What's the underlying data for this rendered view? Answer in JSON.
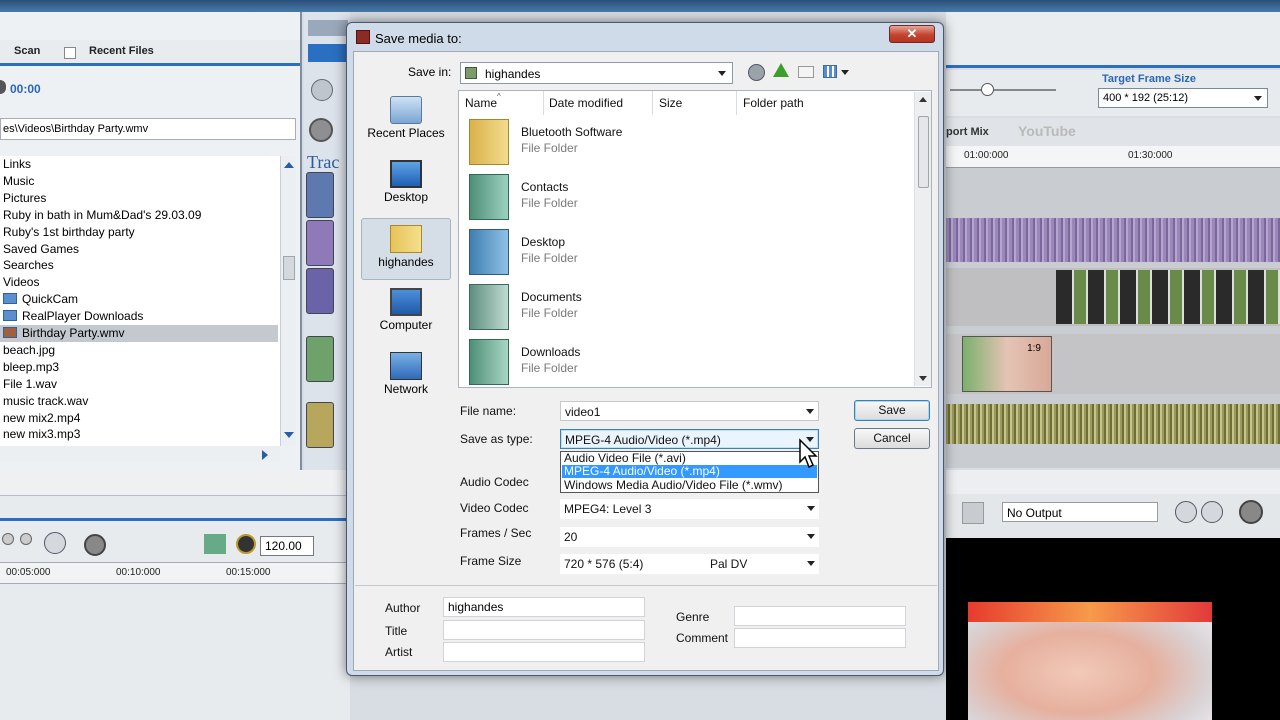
{
  "background": {
    "left_tabs": [
      "Scan",
      "Recent Files"
    ],
    "left_time": "00:00",
    "left_path": "es\\Videos\\Birthday Party.wmv",
    "file_list": [
      {
        "label": "Links",
        "indent": false,
        "folder": false,
        "selected": false
      },
      {
        "label": "Music",
        "indent": false,
        "folder": false,
        "selected": false
      },
      {
        "label": "Pictures",
        "indent": false,
        "folder": false,
        "selected": false
      },
      {
        "label": "Ruby in bath in Mum&Dad's 29.03.09",
        "indent": false,
        "folder": false,
        "selected": false
      },
      {
        "label": "Ruby's 1st birthday party",
        "indent": false,
        "folder": false,
        "selected": false
      },
      {
        "label": "Saved Games",
        "indent": false,
        "folder": false,
        "selected": false
      },
      {
        "label": "Searches",
        "indent": false,
        "folder": false,
        "selected": false
      },
      {
        "label": "Videos",
        "indent": false,
        "folder": false,
        "selected": false
      },
      {
        "label": "QuickCam",
        "indent": true,
        "folder": true,
        "selected": false
      },
      {
        "label": "RealPlayer Downloads",
        "indent": true,
        "folder": true,
        "selected": false
      },
      {
        "label": "Birthday Party.wmv",
        "indent": true,
        "folder": true,
        "selected": true
      },
      {
        "label": "beach.jpg",
        "indent": false,
        "folder": false,
        "selected": false
      },
      {
        "label": "bleep.mp3",
        "indent": false,
        "folder": false,
        "selected": false
      },
      {
        "label": "File 1.wav",
        "indent": false,
        "folder": false,
        "selected": false
      },
      {
        "label": "music track.wav",
        "indent": false,
        "folder": false,
        "selected": false
      },
      {
        "label": "new mix2.mp4",
        "indent": false,
        "folder": false,
        "selected": false
      },
      {
        "label": "new mix3.mp3",
        "indent": false,
        "folder": false,
        "selected": false
      }
    ],
    "mid_title": "Trac",
    "target_frame_size_label": "Target Frame Size",
    "target_frame_size_value": "400  * 192      (25:12)",
    "timeline_tabs": [
      "port Mix",
      "YouTube"
    ],
    "ruler_ticks": [
      "01:00:000",
      "01:30:000"
    ],
    "clip_label": "1:9",
    "bpm": "120.00",
    "bottom_ruler_ticks": [
      "00:05:000",
      "00:10:000",
      "00:15:000"
    ],
    "output_select": "No Output"
  },
  "dialog": {
    "title": "Save media to:",
    "close_label": "✕",
    "save_in_label": "Save in:",
    "save_in_value": "highandes",
    "places": [
      {
        "label": "Recent Places",
        "icon": "recent-places-icon",
        "selected": false
      },
      {
        "label": "Desktop",
        "icon": "desktop-icon",
        "selected": false
      },
      {
        "label": "highandes",
        "icon": "user-folder-icon",
        "selected": true
      },
      {
        "label": "Computer",
        "icon": "computer-icon",
        "selected": false
      },
      {
        "label": "Network",
        "icon": "network-icon",
        "selected": false
      }
    ],
    "columns": [
      "Name",
      "Date modified",
      "Size",
      "Folder path"
    ],
    "files": [
      {
        "name": "Bluetooth Software",
        "type": "File Folder",
        "icon": "folder-icon"
      },
      {
        "name": "Contacts",
        "type": "File Folder",
        "icon": "contacts-folder-icon"
      },
      {
        "name": "Desktop",
        "type": "File Folder",
        "icon": "desktop-folder-icon"
      },
      {
        "name": "Documents",
        "type": "File Folder",
        "icon": "documents-folder-icon"
      },
      {
        "name": "Downloads",
        "type": "File Folder",
        "icon": "downloads-folder-icon"
      }
    ],
    "file_name_label": "File name:",
    "file_name_value": "video1",
    "save_as_type_label": "Save as type:",
    "save_as_type_value": "MPEG-4 Audio/Video  (*.mp4)",
    "type_options": [
      {
        "label": "Audio Video File  (*.avi)",
        "highlighted": false
      },
      {
        "label": "MPEG-4 Audio/Video  (*.mp4)",
        "highlighted": true
      },
      {
        "label": "Windows Media Audio/Video File  (*.wmv)",
        "highlighted": false
      }
    ],
    "save_label": "Save",
    "cancel_label": "Cancel",
    "audio_codec_label": "Audio Codec",
    "video_codec_label": "Video Codec",
    "video_codec_value": "MPEG4: Level 3",
    "fps_label": "Frames / Sec",
    "fps_value": "20",
    "frame_size_label": "Frame Size",
    "frame_size_value": "720   * 576    (5:4)",
    "frame_size_preset": "Pal DV",
    "author_label": "Author",
    "author_value": "highandes",
    "title_label": "Title",
    "title_value": "",
    "artist_label": "Artist",
    "artist_value": "",
    "genre_label": "Genre",
    "genre_value": "",
    "comment_label": "Comment",
    "comment_value": ""
  }
}
